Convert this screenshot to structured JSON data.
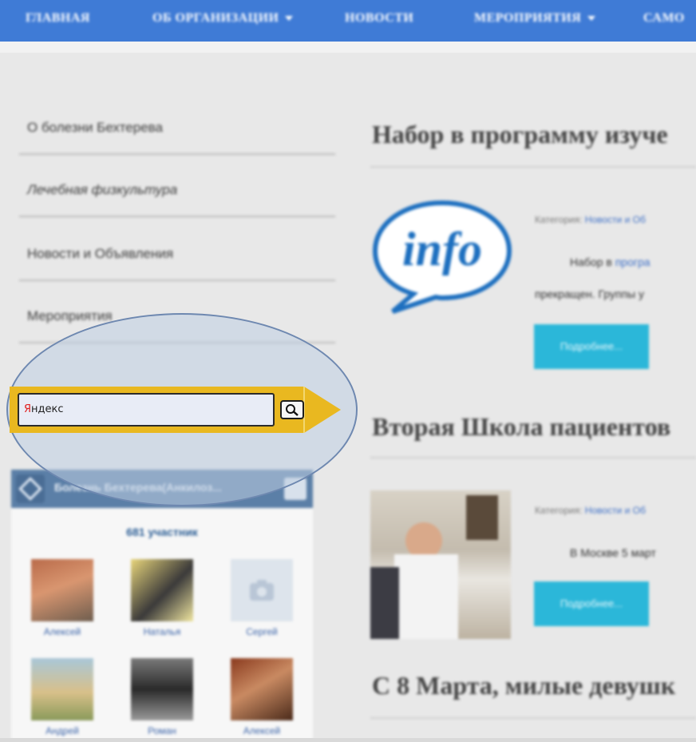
{
  "nav": {
    "items": [
      {
        "label": "ГЛАВНАЯ",
        "dropdown": false
      },
      {
        "label": "ОБ ОРГАНИЗАЦИИ",
        "dropdown": true
      },
      {
        "label": "НОВОСТИ",
        "dropdown": false
      },
      {
        "label": "МЕРОПРИЯТИЯ",
        "dropdown": true
      },
      {
        "label": "САМО",
        "dropdown": false
      }
    ]
  },
  "sidebar": {
    "items": [
      {
        "label": "О болезни Бехтерева"
      },
      {
        "label": "Лечебная физкультура"
      },
      {
        "label": "Новости и Объявления"
      },
      {
        "label": "Мероприятия"
      }
    ]
  },
  "yandex": {
    "input_value": "Яндекс",
    "search_icon": "magnifier-icon"
  },
  "vk": {
    "title": "Болезнь Бехтерева(Анкилоз...",
    "count_text": "681 участник",
    "members": [
      {
        "name": "Алексей"
      },
      {
        "name": "Наталья"
      },
      {
        "name": "Сергей"
      },
      {
        "name": "Андрей"
      },
      {
        "name": "Роман"
      },
      {
        "name": "Алексей"
      }
    ]
  },
  "articles": [
    {
      "title": "Набор в программу изуче",
      "category_label": "Категория:",
      "category_value": "Новости и Об",
      "text_line1_start": "Набор в ",
      "text_line1_link": "програ",
      "text_line2": "прекращен. Группы у",
      "button": "Подробнее..."
    },
    {
      "title": "Вторая Школа пациентов",
      "category_label": "Категория:",
      "category_value": "Новости и Об",
      "text_line1_start": "В Москве 5 март",
      "button": "Подробнее..."
    },
    {
      "title": "С 8 Марта, милые девушк"
    }
  ],
  "info_badge": "info",
  "colors": {
    "nav_bg": "#3f7bd6",
    "yandex_yellow": "#e9b820",
    "button_cyan": "#2bb7d9",
    "vk_header": "#5b7fa7"
  }
}
